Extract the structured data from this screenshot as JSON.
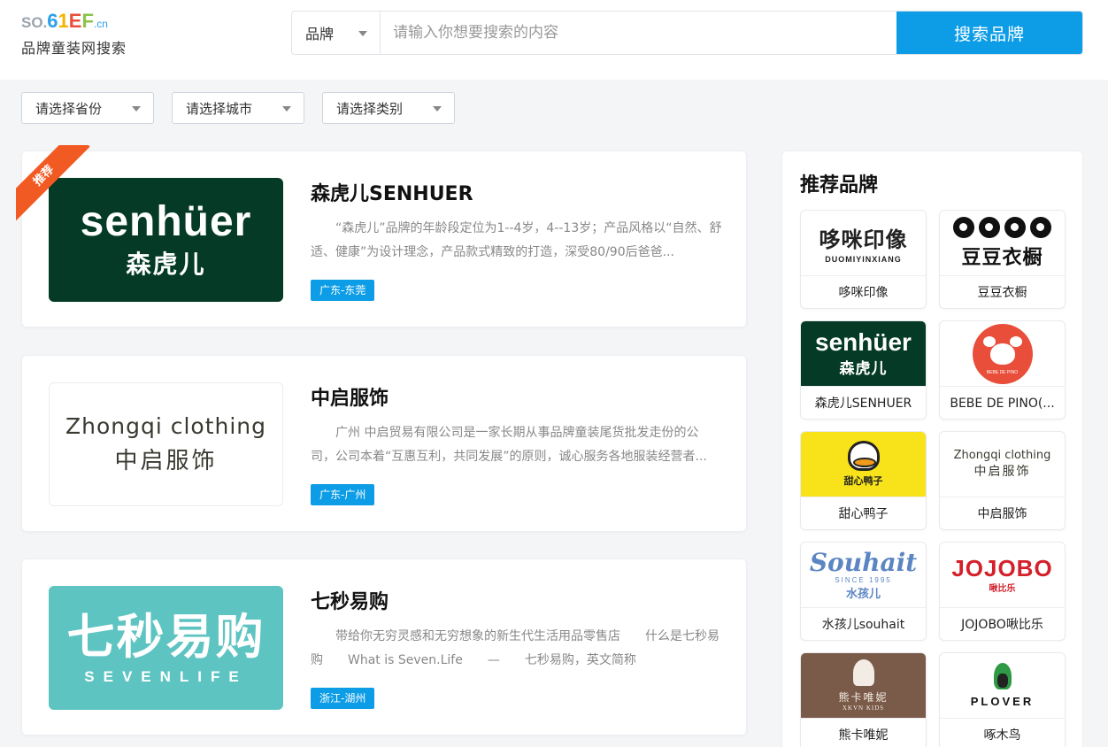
{
  "header": {
    "logo_top": {
      "so": "SO.",
      "six": "6",
      "one": "1",
      "e": "E",
      "f": "F",
      "cn": ".cn"
    },
    "logo_sub": "品牌童装网搜索",
    "search": {
      "select_value": "品牌",
      "placeholder": "请输入你想要搜索的内容",
      "button_label": "搜索品牌"
    }
  },
  "filters": [
    {
      "label": "请选择省份"
    },
    {
      "label": "请选择城市"
    },
    {
      "label": "请选择类别"
    }
  ],
  "ribbon": "推荐",
  "cards": [
    {
      "title": "森虎儿SENHUER",
      "desc": "“森虎儿”品牌的年龄段定位为1--4岁，4--13岁；产品风格以“自然、舒适、健康”为设计理念，产品款式精致的打造，深受80/90后爸爸...",
      "tag": "广东-东莞",
      "logo_en": "senhüer",
      "logo_cn": "森虎儿"
    },
    {
      "title": "中启服饰",
      "desc": "广州 中启贸易有限公司是一家长期从事品牌童装尾货批发走份的公司，公司本着“互惠互利，共同发展”的原则，诚心服务各地服装经营者...",
      "tag": "广东-广州",
      "logo_en": "Zhongqi clothing",
      "logo_cn": "中启服饰"
    },
    {
      "title": "七秒易购",
      "desc": "带给你无穷灵感和无穷想象的新生代生活用品零售店　　什么是七秒易购　　What is Seven.Life　　—　　七秒易购，英文简称Seven.Life，...",
      "tag": "浙江-湖州",
      "logo_cn": "七秒易购",
      "logo_en": "SEVENLIFE"
    }
  ],
  "sidebar": {
    "title": "推荐品牌",
    "brands": [
      {
        "label": "哆咪印像",
        "logo_t1": "哆咪印像",
        "logo_t2": "DUOMIYINXIANG"
      },
      {
        "label": "豆豆衣橱",
        "logo_cn": "豆豆衣橱"
      },
      {
        "label": "森虎儿SENHUER",
        "logo_t1": "senhüer",
        "logo_t2": "森虎儿"
      },
      {
        "label": "BEBE DE PINO(...",
        "logo_txt": "BEBE DE PINO"
      },
      {
        "label": "甜心鸭子",
        "logo_cn": "甜心鸭子"
      },
      {
        "label": "中启服饰",
        "logo_t1": "Zhongqi clothing",
        "logo_t2": "中启服饰"
      },
      {
        "label": "水孩儿souhait",
        "logo_t1": "Souhait",
        "logo_t2": "SINCE 1995",
        "logo_t3": "水孩儿"
      },
      {
        "label": "JOJOBO啾比乐",
        "logo_t1": "JOJOBO",
        "logo_t2": "啾比乐"
      },
      {
        "label": "熊卡唯妮",
        "logo_cn": "熊卡唯妮",
        "logo_en": "XKVN KIDS"
      },
      {
        "label": "啄木鸟",
        "logo_en": "PLOVER"
      }
    ]
  }
}
